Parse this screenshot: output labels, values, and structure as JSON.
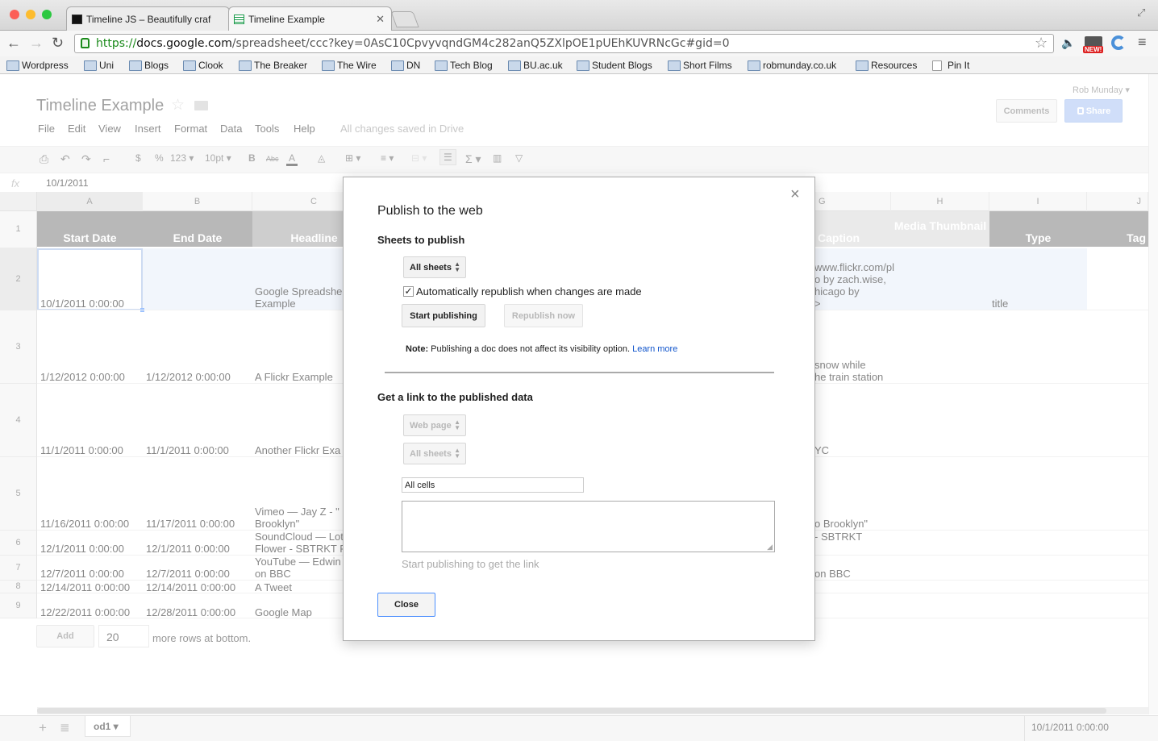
{
  "browser": {
    "tabs": [
      {
        "label": "Timeline JS – Beautifully craf"
      },
      {
        "label": "Timeline Example"
      }
    ],
    "url": {
      "scheme": "https://",
      "host": "docs.google.com",
      "path": "/spreadsheet/ccc?key=0AsC10CpvyvqndGM4c282anQ5ZXlpOE1pUEhKUVRNcGc#gid=0"
    },
    "new_badge": "NEW!",
    "bookmarks": [
      {
        "label": "Wordpress"
      },
      {
        "label": "Uni"
      },
      {
        "label": "Blogs"
      },
      {
        "label": "Clook"
      },
      {
        "label": "The Breaker"
      },
      {
        "label": "The Wire"
      },
      {
        "label": "DN"
      },
      {
        "label": "Tech Blog"
      },
      {
        "label": "BU.ac.uk"
      },
      {
        "label": "Student Blogs"
      },
      {
        "label": "Short Films"
      },
      {
        "label": "robmunday.co.uk"
      },
      {
        "label": "Resources"
      },
      {
        "label": "Pin It"
      }
    ]
  },
  "doc": {
    "title": "Timeline Example",
    "user": "Rob Munday",
    "comments": "Comments",
    "share": "Share",
    "menu": [
      "File",
      "Edit",
      "View",
      "Insert",
      "Format",
      "Data",
      "Tools",
      "Help"
    ],
    "saved_status": "All changes saved in Drive"
  },
  "toolbar": {
    "currency": "$",
    "percent": "%",
    "number_format": "123",
    "font_size": "10pt",
    "bold": "B",
    "strike": "Abc",
    "text_color": "A",
    "sum": "Σ"
  },
  "formula": {
    "fx": "fx",
    "value": "10/1/2011"
  },
  "grid": {
    "columns": [
      "A",
      "B",
      "C",
      "G",
      "H",
      "I",
      "J"
    ],
    "rows": [
      "1",
      "2",
      "3",
      "4",
      "5",
      "6",
      "7",
      "8",
      "9"
    ],
    "header_row": [
      "Start Date",
      "End Date",
      "Headline",
      "Caption",
      "Media Thumbnail",
      "Type",
      "Tag"
    ],
    "cells": {
      "a2": "10/1/2011 0:00:00",
      "c2": [
        "Google Spreadshee",
        "Example"
      ],
      "g2": [
        "www.flickr.com/pl",
        "o by zach.wise,",
        "hicago by",
        ">"
      ],
      "i2": "title",
      "a3": "1/12/2012 0:00:00",
      "b3": "1/12/2012 0:00:00",
      "c3": "A Flickr Example",
      "g3": [
        "snow while",
        "he train station"
      ],
      "a4": "11/1/2011 0:00:00",
      "b4": "11/1/2011 0:00:00",
      "c4": "Another Flickr Exa",
      "g4": "YC",
      "a5": "11/16/2011 0:00:00",
      "b5": "11/17/2011 0:00:00",
      "c5": [
        "Vimeo — Jay Z - \"",
        "Brooklyn\""
      ],
      "g5": "o Brooklyn\"",
      "a6": "12/1/2011 0:00:00",
      "b6": "12/1/2011 0:00:00",
      "c6": [
        "SoundCloud — Lot",
        "Flower - SBTRKT F"
      ],
      "g6": "- SBTRKT",
      "a7": "12/7/2011 0:00:00",
      "b7": "12/7/2011 0:00:00",
      "c7": [
        "YouTube — Edwin",
        "on BBC"
      ],
      "g7": "on BBC",
      "a8": "12/14/2011 0:00:00",
      "b8": "12/14/2011 0:00:00",
      "c8": "A Tweet",
      "a9": "12/22/2011 0:00:00",
      "b9": "12/28/2011 0:00:00",
      "c9": "Google Map"
    },
    "add_button": "Add",
    "add_rows_value": "20",
    "add_rows_suffix": "more rows at bottom."
  },
  "dialog": {
    "title": "Publish to the web",
    "close_x": "×",
    "section1": "Sheets to publish",
    "sheets_select": "All sheets",
    "auto_republish": "Automatically republish when changes are made",
    "auto_republish_checked": true,
    "start_publishing": "Start publishing",
    "republish_now": "Republish now",
    "note_label": "Note:",
    "note_text": "Publishing a doc does not affect its visibility option.",
    "learn_more": "Learn more",
    "section2": "Get a link to the published data",
    "format_select": "Web page",
    "sheets_select2": "All sheets",
    "range_value": "All cells",
    "link_hint": "Start publishing to get the link",
    "close_button": "Close"
  },
  "sheetbar": {
    "sheet_tab": "od1",
    "status_value": "10/1/2011 0:00:00"
  },
  "colors": {
    "header_dark": "#7f7f7f",
    "header_mid": "#a6a6a6",
    "header_light": "#d9d9d9",
    "selection": "#e8eef9",
    "share_blue": "#a9c4f5",
    "link_blue": "#1155cc"
  }
}
